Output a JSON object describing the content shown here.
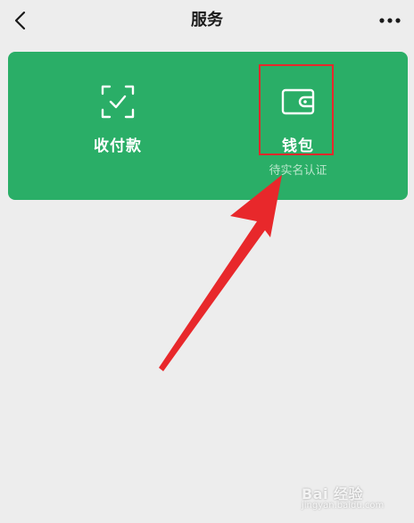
{
  "header": {
    "title": "服务",
    "back_icon": "chevron-left-icon",
    "more_icon": "more-horizontal-icon"
  },
  "services": {
    "pay": {
      "label": "收付款",
      "icon": "scan-check-icon"
    },
    "wallet": {
      "label": "钱包",
      "subtitle": "待实名认证",
      "icon": "wallet-icon"
    }
  },
  "colors": {
    "background": "#ededed",
    "card_green": "#2aae67",
    "annotation_red": "#e8282b"
  },
  "watermark": {
    "text": "Bai 经验",
    "sub": "jingyan.baidu.com"
  }
}
